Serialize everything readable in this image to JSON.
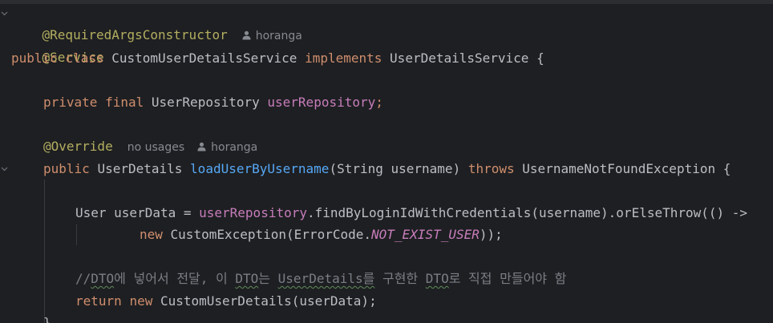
{
  "editor": {
    "line1": {
      "annotation": "@RequiredArgsConstructor",
      "author_hint": "horanga"
    },
    "line2": {
      "annotation": "@Service"
    },
    "line3": {
      "kw_public": "public",
      "kw_class": "class",
      "class_name": "CustomUserDetailsService",
      "kw_implements": "implements",
      "interface_name": "UserDetailsService",
      "brace": "{"
    },
    "line4": {
      "kw_private": "private",
      "kw_final": "final",
      "type": "UserRepository",
      "field": "userRepository",
      "semicolon": ";"
    },
    "line5": {
      "annotation": "@Override",
      "usage_hint": "no usages",
      "author_hint": "horanga"
    },
    "line6": {
      "kw_public": "public",
      "return_type": "UserDetails",
      "method": "loadUserByUsername",
      "params": "(String username)",
      "kw_throws": "throws",
      "exception": "UsernameNotFoundException",
      "brace": "{"
    },
    "line7": {
      "decl": "User userData = ",
      "field": "userRepository",
      "call": ".findByLoginIdWithCredentials(username).orElseThrow(() ->"
    },
    "line8": {
      "kw_new": "new",
      "ctor": " CustomException(ErrorCode.",
      "constant": "NOT_EXIST_USER",
      "end": "));"
    },
    "line9": {
      "c1": "//",
      "c2": "DTO",
      "c3": "에 넣어서 전달, 이 ",
      "c4": "DTO",
      "c5": "는 ",
      "c6": "UserDetails",
      "c7": "를",
      "c8": " 구현한 ",
      "c9": "DTO",
      "c10": "로 직접 만들어야 함"
    },
    "line10": {
      "kw_return": "return",
      "kw_new": "new",
      "ctor": " CustomUserDetails(userData);"
    },
    "line11": {
      "brace": "}"
    }
  }
}
